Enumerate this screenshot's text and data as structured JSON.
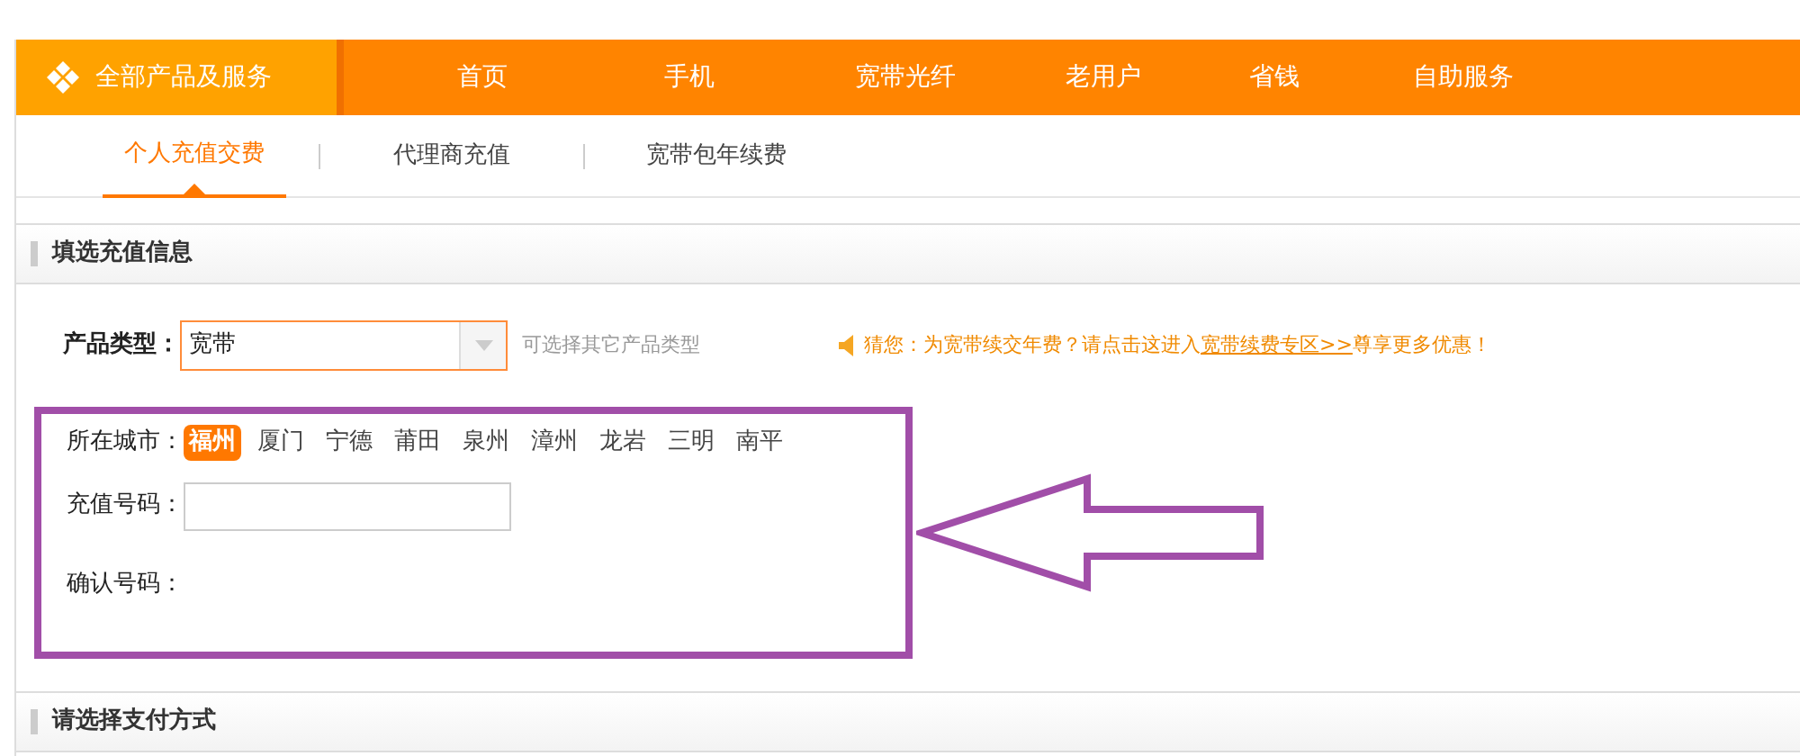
{
  "nav": {
    "all_products": "全部产品及服务",
    "items": [
      {
        "label": "首页"
      },
      {
        "label": "手机"
      },
      {
        "label": "宽带光纤"
      },
      {
        "label": "老用户"
      },
      {
        "label": "省钱"
      },
      {
        "label": "自助服务"
      }
    ]
  },
  "sub_tabs": [
    {
      "label": "个人充值交费",
      "selected": true
    },
    {
      "label": "代理商充值",
      "selected": false
    },
    {
      "label": "宽带包年续费",
      "selected": false
    }
  ],
  "section_title": "填选充值信息",
  "product_type": {
    "label": "产品类型：",
    "value": "宽带",
    "hint": "可选择其它产品类型"
  },
  "notice": {
    "text": "猜您：为宽带续交年费？请点击这进入",
    "link": "宽带续费专区>>",
    "suffix": "尊享更多优惠！"
  },
  "city": {
    "label": "所在城市：",
    "options": [
      {
        "label": "福州",
        "selected": true
      },
      {
        "label": "厦门",
        "selected": false
      },
      {
        "label": "宁德",
        "selected": false
      },
      {
        "label": "莆田",
        "selected": false
      },
      {
        "label": "泉州",
        "selected": false
      },
      {
        "label": "漳州",
        "selected": false
      },
      {
        "label": "龙岩",
        "selected": false
      },
      {
        "label": "三明",
        "selected": false
      },
      {
        "label": "南平",
        "selected": false
      }
    ]
  },
  "recharge_number": {
    "label": "充值号码："
  },
  "confirm_number": {
    "label": "确认号码："
  },
  "payment_title": "请选择支付方式"
}
